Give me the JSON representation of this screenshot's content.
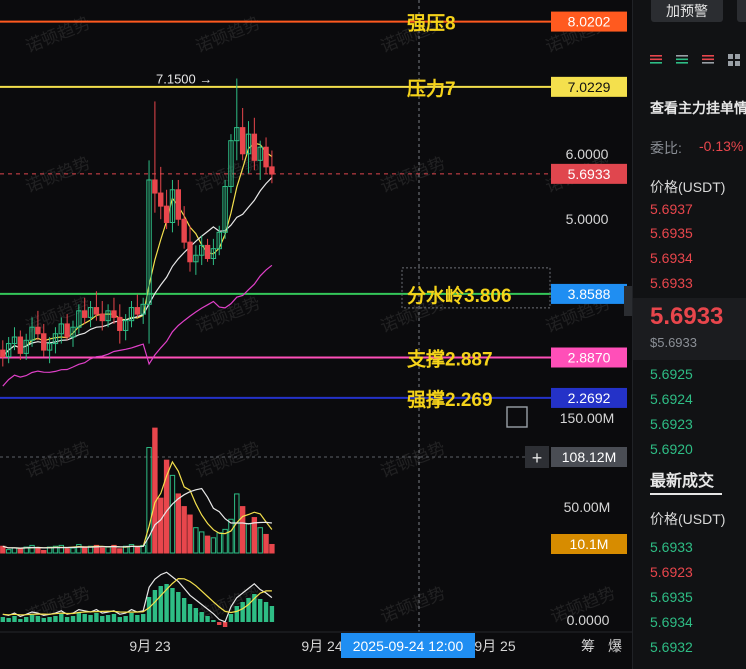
{
  "chart_data": {
    "type": "candlestick",
    "time_axis": {
      "labels": [
        "9月 23",
        "9月 24",
        "9月 25"
      ],
      "crosshair_label": "2025-09-24 12:00"
    },
    "price_axis": {
      "ticks": [
        "6.0000",
        "5.0000"
      ],
      "range": [
        1.55,
        8.35
      ],
      "current_price": "5.6933",
      "max_marker": "7.1500",
      "current_price_color": "#e0464e"
    },
    "levels": [
      {
        "label": "强压8",
        "value": 8.0202,
        "value_label": "8.0202",
        "color": "#ff5a1f",
        "label_color": "#f5d31a"
      },
      {
        "label": "压力7",
        "value": 7.0229,
        "value_label": "7.0229",
        "color": "#f4e04d",
        "label_color": "#f5d31a"
      },
      {
        "label": "分水岭3.806",
        "value": 3.8588,
        "value_label": "3.8588",
        "color": "#34c759",
        "label_color": "#f5d31a",
        "tag_color": "#1f8ef2"
      },
      {
        "label": "支撑2.887",
        "value": 2.887,
        "value_label": "2.8870",
        "color": "#ff4fb8",
        "label_color": "#f5d31a"
      },
      {
        "label": "强撑2.269",
        "value": 2.2692,
        "value_label": "2.2692",
        "color": "#2432c8",
        "label_color": "#f5d31a"
      }
    ],
    "candles_ohlc": [
      [
        3.0,
        3.15,
        2.75,
        2.9
      ],
      [
        2.9,
        3.2,
        2.8,
        3.1
      ],
      [
        3.1,
        3.35,
        3.0,
        3.2
      ],
      [
        3.2,
        3.3,
        2.85,
        2.95
      ],
      [
        2.95,
        3.25,
        2.85,
        3.15
      ],
      [
        3.15,
        3.5,
        3.05,
        3.35
      ],
      [
        3.35,
        3.6,
        3.15,
        3.25
      ],
      [
        3.25,
        3.4,
        2.9,
        3.0
      ],
      [
        3.0,
        3.2,
        2.8,
        3.1
      ],
      [
        3.1,
        3.35,
        2.95,
        3.25
      ],
      [
        3.25,
        3.5,
        3.1,
        3.4
      ],
      [
        3.4,
        3.55,
        3.15,
        3.2
      ],
      [
        3.2,
        3.45,
        3.05,
        3.35
      ],
      [
        3.35,
        3.7,
        3.25,
        3.6
      ],
      [
        3.6,
        3.8,
        3.4,
        3.5
      ],
      [
        3.5,
        3.75,
        3.35,
        3.65
      ],
      [
        3.65,
        3.9,
        3.45,
        3.55
      ],
      [
        3.55,
        3.75,
        3.3,
        3.45
      ],
      [
        3.45,
        3.7,
        3.35,
        3.6
      ],
      [
        3.6,
        3.8,
        3.4,
        3.5
      ],
      [
        3.5,
        3.7,
        3.1,
        3.3
      ],
      [
        3.3,
        3.55,
        3.15,
        3.45
      ],
      [
        3.45,
        3.75,
        3.35,
        3.65
      ],
      [
        3.65,
        3.85,
        3.5,
        3.55
      ],
      [
        3.55,
        3.8,
        3.4,
        3.7
      ],
      [
        3.7,
        5.9,
        3.1,
        5.6
      ],
      [
        5.6,
        6.8,
        5.1,
        5.4
      ],
      [
        5.4,
        5.8,
        5.0,
        5.2
      ],
      [
        5.2,
        5.45,
        4.85,
        4.95
      ],
      [
        4.95,
        5.6,
        4.8,
        5.45
      ],
      [
        5.45,
        5.6,
        4.9,
        5.0
      ],
      [
        5.0,
        5.2,
        4.55,
        4.65
      ],
      [
        4.65,
        4.9,
        4.2,
        4.35
      ],
      [
        4.35,
        4.6,
        4.15,
        4.45
      ],
      [
        4.45,
        4.75,
        4.3,
        4.6
      ],
      [
        4.6,
        4.7,
        4.35,
        4.4
      ],
      [
        4.4,
        4.7,
        4.3,
        4.55
      ],
      [
        4.55,
        4.9,
        4.45,
        4.8
      ],
      [
        4.8,
        5.6,
        4.7,
        5.5
      ],
      [
        5.5,
        6.3,
        5.4,
        6.2
      ],
      [
        6.2,
        7.15,
        5.9,
        6.4
      ],
      [
        6.4,
        6.7,
        5.9,
        6.0
      ],
      [
        6.0,
        6.5,
        5.7,
        6.3
      ],
      [
        6.3,
        6.55,
        5.75,
        5.9
      ],
      [
        5.9,
        6.2,
        5.6,
        6.1
      ],
      [
        6.1,
        6.25,
        5.7,
        5.8
      ],
      [
        5.8,
        6.05,
        5.55,
        5.69
      ]
    ],
    "volume_axis": {
      "ticks": [
        "150.00M",
        "50.00M",
        "0.0000"
      ],
      "cursor_label": "108.12M",
      "current": "10.1M"
    },
    "volume_millions": [
      8,
      4,
      6,
      5,
      7,
      9,
      6,
      3,
      7,
      8,
      9,
      5,
      6,
      10,
      7,
      8,
      9,
      6,
      7,
      9,
      5,
      8,
      10,
      7,
      9,
      125,
      148,
      65,
      110,
      92,
      70,
      55,
      45,
      30,
      25,
      20,
      18,
      24,
      28,
      40,
      70,
      55,
      35,
      42,
      30,
      22,
      10.1
    ],
    "volume_up": [
      0,
      1,
      1,
      0,
      1,
      1,
      0,
      0,
      1,
      1,
      1,
      0,
      1,
      1,
      0,
      1,
      0,
      0,
      1,
      0,
      0,
      1,
      1,
      0,
      1,
      1,
      0,
      0,
      0,
      1,
      0,
      0,
      0,
      1,
      1,
      0,
      1,
      1,
      1,
      1,
      1,
      0,
      1,
      0,
      1,
      0,
      0
    ],
    "macd_hist": [
      0.5,
      0.4,
      0.6,
      0.3,
      0.5,
      0.7,
      0.6,
      0.4,
      0.5,
      0.6,
      0.8,
      0.5,
      0.6,
      0.9,
      0.8,
      0.7,
      0.9,
      0.6,
      0.7,
      0.8,
      0.5,
      0.6,
      0.9,
      0.7,
      0.8,
      2.5,
      3.2,
      3.6,
      3.8,
      3.4,
      3.0,
      2.4,
      1.8,
      1.4,
      1.0,
      0.6,
      0.2,
      -0.3,
      -0.5,
      0.8,
      1.6,
      2.0,
      2.4,
      2.8,
      2.3,
      2.0,
      1.6
    ],
    "watermark": "诺顿趋势"
  },
  "side_panel": {
    "alert_button": "加预警",
    "depth_title": "查看主力挂单情",
    "ratio_label": "委比:",
    "ratio_value": "-0.13%",
    "price_header": "价格(USDT)",
    "asks": [
      "5.6937",
      "5.6935",
      "5.6934",
      "5.6933"
    ],
    "last_price": "5.6933",
    "last_price_fiat": "$5.6933",
    "bids": [
      "5.6925",
      "5.6924",
      "5.6923",
      "5.6920"
    ],
    "trades_title": "最新成交",
    "trades_header": "价格(USDT)",
    "trades": [
      {
        "price": "5.6933",
        "side": "buy"
      },
      {
        "price": "5.6923",
        "side": "sell"
      },
      {
        "price": "5.6935",
        "side": "buy"
      },
      {
        "price": "5.6934",
        "side": "buy"
      },
      {
        "price": "5.6932",
        "side": "buy"
      }
    ],
    "footer_labels": [
      "筹",
      "爆"
    ]
  },
  "colors": {
    "up": "#2ebd85",
    "down": "#e8464c",
    "ma_fast": "#f4e04d",
    "ma_mid": "#e8e8e8",
    "bb_lower": "#e040c8",
    "crosshair_tag": "#1f8ef2"
  }
}
